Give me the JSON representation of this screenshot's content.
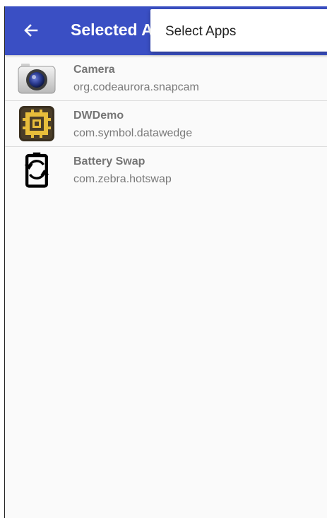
{
  "appbar": {
    "title": "Selected Apps",
    "back_icon": "arrow-left-icon",
    "background": "#3a4fc4"
  },
  "overflow_menu": {
    "items": [
      {
        "label": "Select Apps"
      }
    ]
  },
  "apps": [
    {
      "name": "Camera",
      "package": "org.codeaurora.snapcam",
      "icon": "camera-icon"
    },
    {
      "name": "DWDemo",
      "package": "com.symbol.datawedge",
      "icon": "datawedge-icon"
    },
    {
      "name": "Battery Swap",
      "package": "com.zebra.hotswap",
      "icon": "battery-swap-icon"
    }
  ]
}
